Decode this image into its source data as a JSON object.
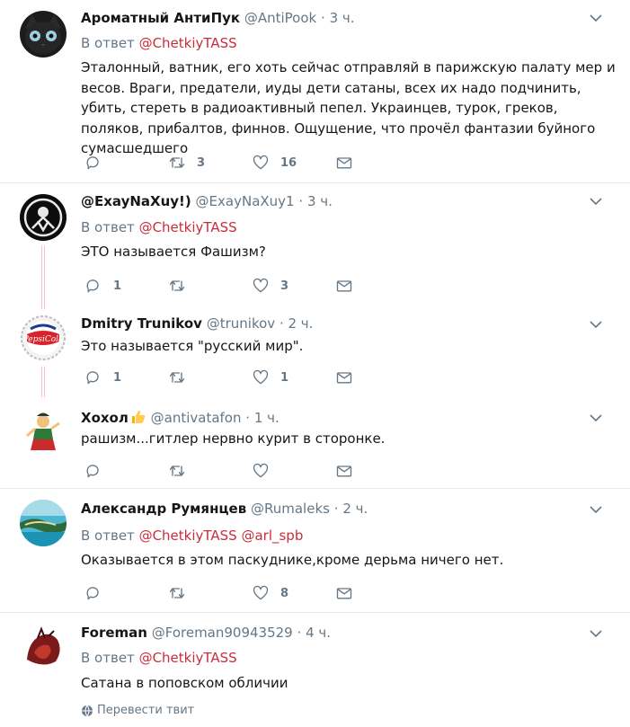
{
  "tweets": [
    {
      "name": "Ароматный АнтиПук",
      "handle": "@AntiPook",
      "dot": "·",
      "time": "3 ч.",
      "reply_prefix": "В ответ",
      "mentions": [
        "@ChetkiyTASS"
      ],
      "text": "Эталонный, ватник, его хоть сейчас отправляй в парижскую палату мер и весов. Враги, предатели, иуды дети сатаны, всех их надо подчинить, убить, стереть в радиоактивный пепел. Украинцев, турок, греков, поляков, прибалтов, финнов. Ощущение, что прочёл фантазии буйного сумасшедшего",
      "replies": "",
      "retweets": "3",
      "likes": "16"
    },
    {
      "name": "@ExayNaXuy!)",
      "handle": "@ExayNaXuy1",
      "dot": "·",
      "time": "3 ч.",
      "reply_prefix": "В ответ",
      "mentions": [
        "@ChetkiyTASS"
      ],
      "text": "ЭТО называется Фашизм?",
      "replies": "1",
      "retweets": "",
      "likes": "3"
    },
    {
      "name": "Dmitry Trunikov",
      "handle": "@trunikov",
      "dot": "·",
      "time": "2 ч.",
      "text": "Это называется \"русский мир\".",
      "replies": "1",
      "retweets": "",
      "likes": "1"
    },
    {
      "name": "Хохол",
      "handle": "@antivatafon",
      "dot": "·",
      "time": "1 ч.",
      "text": "рашизм...гитлер нервно курит в сторонке.",
      "replies": "",
      "retweets": "",
      "likes": ""
    },
    {
      "name": "Александр Румянцев",
      "handle": "@Rumaleks",
      "dot": "·",
      "time": "2 ч.",
      "reply_prefix": "В ответ",
      "mentions": [
        "@ChetkiyTASS",
        "@arl_spb"
      ],
      "text": "Оказывается в этом паскуднике,кроме дерьма ничего нет.",
      "replies": "",
      "retweets": "",
      "likes": "8"
    },
    {
      "name": "Foreman",
      "handle": "@Foreman90943529",
      "dot": "·",
      "time": "4 ч.",
      "reply_prefix": "В ответ",
      "mentions": [
        "@ChetkiyTASS"
      ],
      "text": "Сатана в поповском обличии",
      "translate": "Перевести твит"
    }
  ],
  "colors": {
    "accent": "#c92d3b",
    "muted": "#657786",
    "text": "#14171a",
    "separator": "#e6ecf0"
  }
}
